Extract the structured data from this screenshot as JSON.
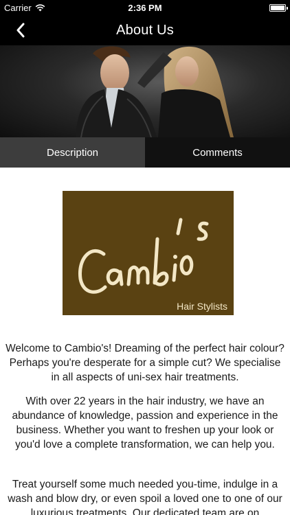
{
  "status": {
    "carrier": "Carrier",
    "time": "2:36 PM",
    "battery_level": 1.0
  },
  "nav": {
    "title": "About Us",
    "back_icon": "chevron-left-icon"
  },
  "tabs": [
    {
      "label": "Description",
      "active": true
    },
    {
      "label": "Comments",
      "active": false
    }
  ],
  "logo": {
    "brand": "Cambio's",
    "tagline": "Hair Stylists"
  },
  "paragraphs": [
    "Welcome to Cambio's! Dreaming of the perfect hair colour? Perhaps you're desperate for a simple cut? We specialise in all aspects of uni-sex hair treatments.",
    "With over 22 years in the hair industry, we have an abundance of knowledge, passion and experience in the business. Whether you want to freshen up your look or you'd love a complete transformation, we can help you.",
    "Treat yourself some much needed you-time, indulge in a wash and blow dry, or even spoil a loved one to one of our luxurious treatments. Our dedicated team are on"
  ],
  "colors": {
    "bar": "#000000",
    "tab_active": "#3d3d3d",
    "tab_inactive": "#111111",
    "logo_bg": "#5a4212",
    "logo_text": "#f3e7c6"
  }
}
